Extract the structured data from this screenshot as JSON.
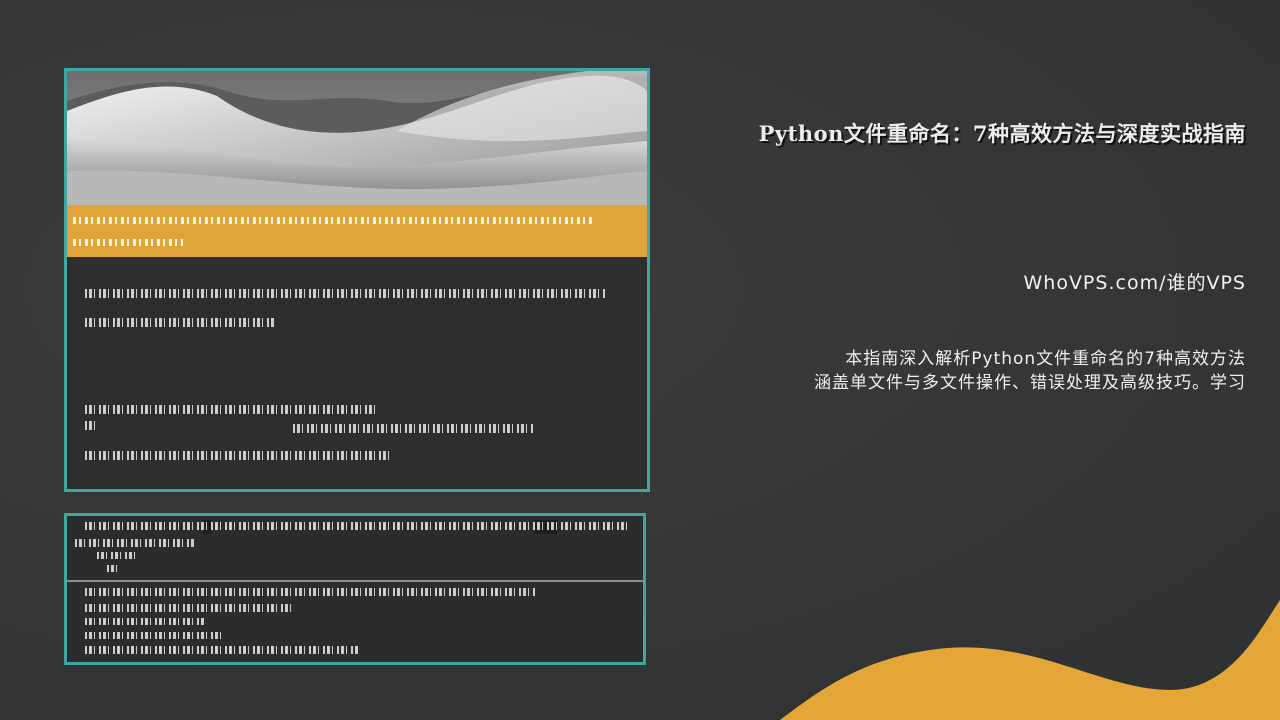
{
  "article": {
    "title": "Python文件重命名：7种高效方法与深度实战指南",
    "site": "WhoVPS.com/谁的VPS",
    "description_lines": [
      "本指南深入解析Python文件重命名的7种高效方法",
      "涵盖单文件与多文件操作、错误处理及高级技巧。学习"
    ]
  },
  "colors": {
    "background": "#37383a",
    "accent_teal": "#3fa7a1",
    "accent_yellow": "#e1a43a",
    "text": "#efefef"
  }
}
